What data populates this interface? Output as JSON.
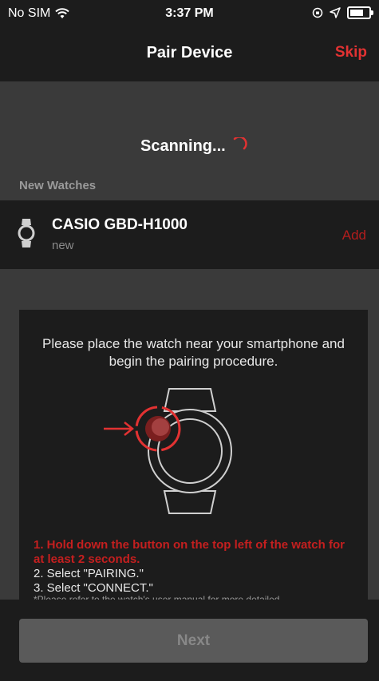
{
  "status_bar": {
    "carrier": "No SIM",
    "time": "3:37 PM"
  },
  "nav": {
    "title": "Pair Device",
    "skip": "Skip"
  },
  "scanning": {
    "label": "Scanning..."
  },
  "new_watches": {
    "header": "New Watches",
    "devices": [
      {
        "name": "CASIO GBD-H1000",
        "status": "new",
        "action": "Add"
      }
    ]
  },
  "instructions": {
    "intro": "Please place the watch near your smartphone and begin the pairing procedure.",
    "step1": "1. Hold down the button on the top left of the watch for at least 2 seconds.",
    "step2": "2. Select \"PAIRING.\"",
    "step3": "3. Select \"CONNECT.\"",
    "note": "*Please refer to the watch's user manual for more detailed"
  },
  "footer": {
    "next": "Next"
  },
  "colors": {
    "accent": "#e23232",
    "background": "#3a3a3a",
    "surface": "#1c1c1c"
  }
}
